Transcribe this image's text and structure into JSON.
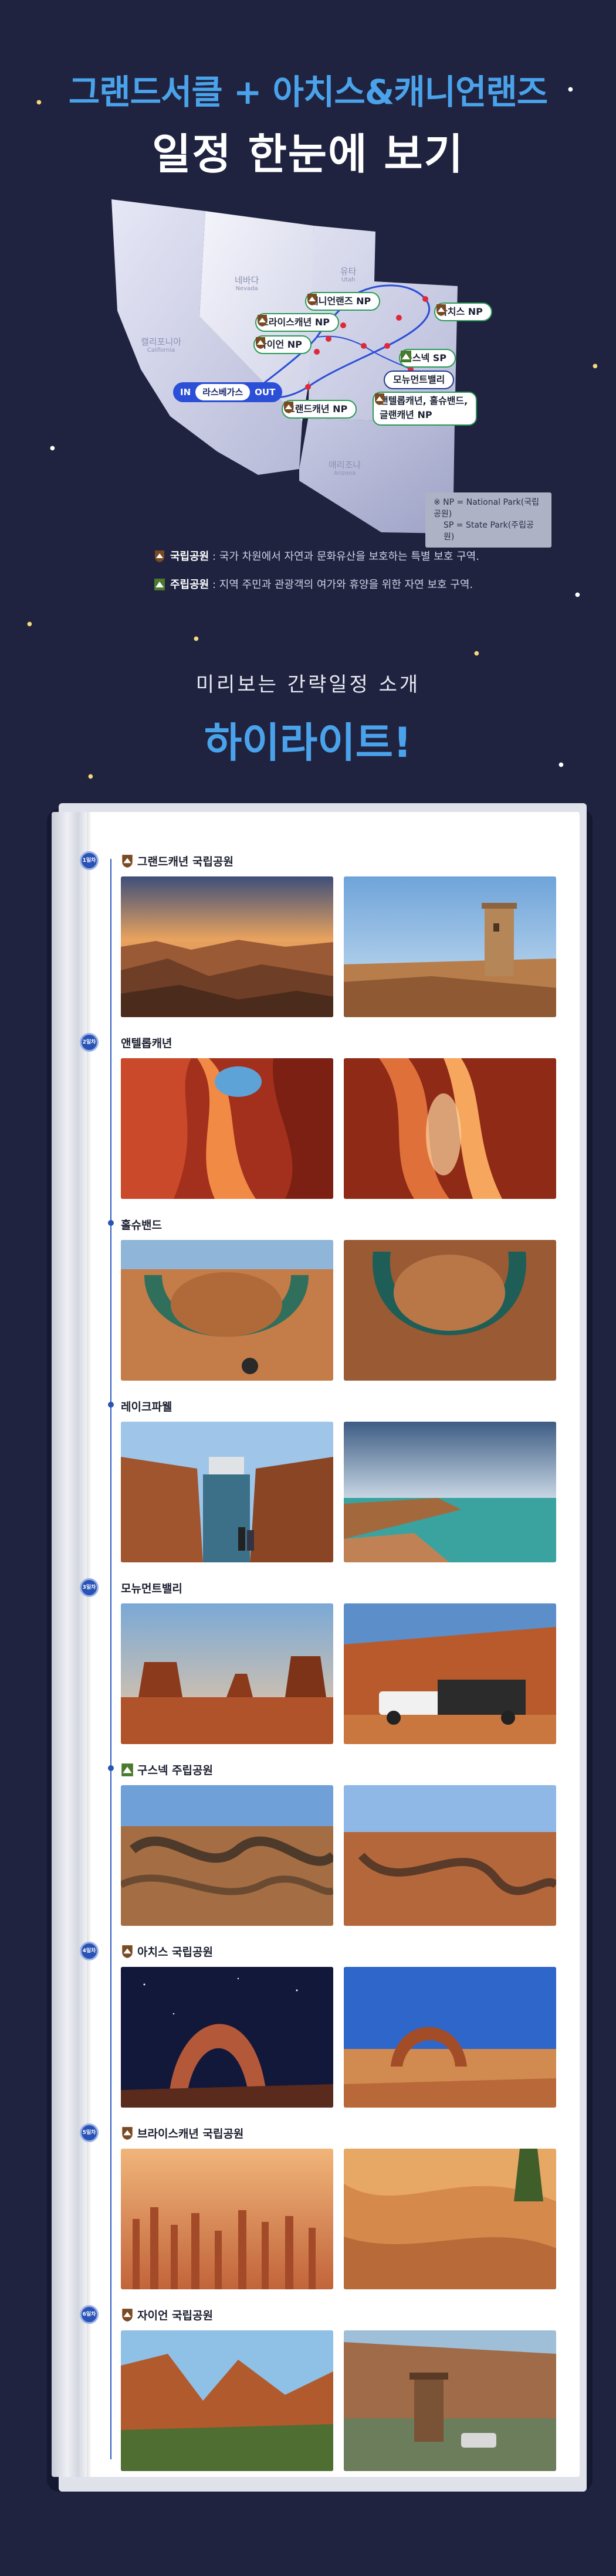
{
  "header": {
    "line1": "그랜드서클 + 아치스&캐니언랜즈",
    "line2": "일정 한눈에 보기"
  },
  "map": {
    "states": [
      {
        "ko": "네바다",
        "en": "Nevada"
      },
      {
        "ko": "유타",
        "en": "Utah"
      },
      {
        "ko": "캘리포니아",
        "en": "California"
      },
      {
        "ko": "애리조나",
        "en": "Arizona"
      }
    ],
    "pins": {
      "canyonlands": "캐니언랜즈 NP",
      "bryce": "브라이스캐년 NP",
      "zion": "자이언 NP",
      "arches": "아치스 NP",
      "goosenecks": "구스넥 SP",
      "monument": "모뉴먼트밸리",
      "antelope_line1": "앤텔롭캐년, 홀슈밴드,",
      "antelope_line2": "글랜캐년 NP",
      "grand": "그랜드캐년 NP"
    },
    "city": {
      "in": "IN",
      "name": "라스베가스",
      "out": "OUT"
    },
    "note": {
      "np": "※ NP = National Park(국립공원)",
      "sp": "SP = State Park(주립공원)"
    }
  },
  "legend": {
    "national_label": "국립공원",
    "national_desc": " : 국가 차원에서 자연과 문화유산을 보호하는 특별 보호 구역.",
    "state_label": "주립공원",
    "state_desc": " : 지역 주민과 관광객의 여가와 휴양을 위한 자연 보호 구역."
  },
  "highlights": {
    "subtitle": "미리보는 간략일정 소개",
    "title": "하이라이트!"
  },
  "days": [
    {
      "badge": "1일차",
      "title": "그랜드캐년 국립공원",
      "icon": "national-park-badge"
    },
    {
      "badge": "2일차",
      "title": "앤텔롭캐년",
      "icon": ""
    },
    {
      "badge": "",
      "title": "홀슈밴드",
      "icon": ""
    },
    {
      "badge": "",
      "title": "레이크파웰",
      "icon": ""
    },
    {
      "badge": "3일차",
      "title": "모뉴먼트밸리",
      "icon": ""
    },
    {
      "badge": "",
      "title": "구스넥 주립공원",
      "icon": "state-park-badge"
    },
    {
      "badge": "4일차",
      "title": "아치스 국립공원",
      "icon": "national-park-badge"
    },
    {
      "badge": "5일차",
      "title": "브라이스캐년 국립공원",
      "icon": "national-park-badge"
    },
    {
      "badge": "6일차",
      "title": "자이언 국립공원",
      "icon": "national-park-badge"
    }
  ],
  "colors": {
    "background": "#1f2340",
    "accent_blue": "#4aa3ea",
    "timeline": "#2953b5",
    "pin_border": "#2a9a56"
  }
}
